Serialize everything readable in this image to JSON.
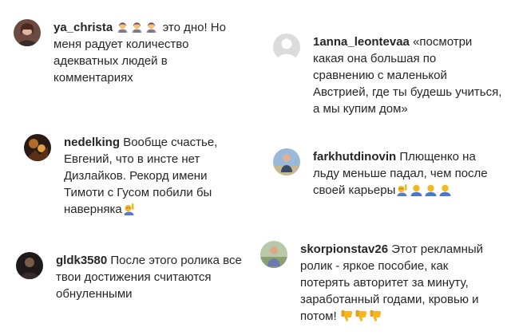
{
  "comments": [
    {
      "username": "ya_christa",
      "line1_text": "это дно! Но",
      "lines": [
        "меня радует количество",
        "адекватных людей в",
        "комментариях"
      ],
      "emoji_icons": [
        "woman-technologist-emoji",
        "woman-technologist-emoji",
        "woman-technologist-emoji"
      ]
    },
    {
      "username": "1anna_leontevaa",
      "line1_text": "«посмотри",
      "lines": [
        "какая она большая по",
        "сравнению с маленькой",
        "Австрией, где ты будешь учиться,",
        "а мы купим дом»"
      ]
    },
    {
      "username": "nedelking",
      "line1_text": "Вообще счастье,",
      "lines": [
        "Евгений, что в инсте нет",
        "Дизлайков. Рекорд имени",
        "Тимоти с Гусом побили бы"
      ],
      "last_text": "наверняка",
      "last_emoji": "person-raising-hand-emoji"
    },
    {
      "username": "farkhutdinovin",
      "line1_text": "Плющенко на",
      "lines": [
        "льду меньше падал, чем после"
      ],
      "last_text": "своей карьеры",
      "last_emojis": [
        "person-raising-hand-emoji",
        "bust-silhouette-emoji",
        "bust-silhouette-emoji",
        "bust-silhouette-emoji"
      ]
    },
    {
      "username": "gldk3580",
      "line1_text": "После этого ролика все",
      "lines": [
        "твои достижения считаются",
        "обнуленными"
      ]
    },
    {
      "username": "skorpionstav26",
      "line1_text": "Этот рекламный",
      "lines": [
        "ролик - яркое пособие, как",
        "потерять авторитет за минуту,",
        "заработанный годами, кровью и"
      ],
      "last_text": "потом!",
      "last_emojis": [
        "thumbs-down-emoji",
        "thumbs-down-emoji",
        "thumbs-down-emoji"
      ]
    }
  ],
  "colors": {
    "text": "#262626",
    "emoji_yellow": "#f5b71f",
    "emoji_purple": "#a78bd4",
    "default_avatar_bg": "#dbdbdb"
  }
}
